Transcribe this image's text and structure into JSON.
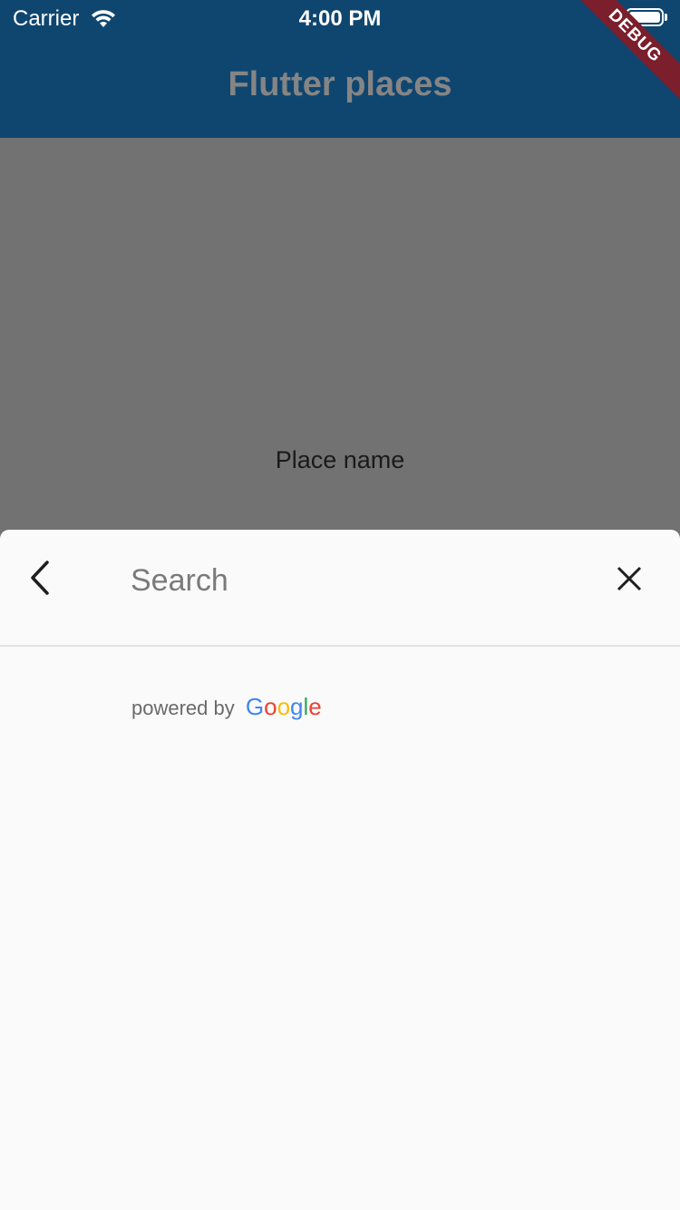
{
  "status_bar": {
    "carrier": "Carrier",
    "time": "4:00 PM",
    "wifi_icon": "wifi-icon",
    "battery_icon": "battery-icon"
  },
  "app_bar": {
    "title": "Flutter places",
    "background_color": "#0f4670"
  },
  "debug_banner": {
    "label": "DEBUG",
    "color": "#7a1f2b"
  },
  "body": {
    "place_name": "Place name"
  },
  "search_sheet": {
    "back_icon": "chevron-left-icon",
    "search_placeholder": "Search",
    "search_value": "",
    "clear_icon": "close-icon",
    "attribution_prefix": "powered by",
    "google_letters": [
      {
        "char": "G",
        "color": "#4285F4"
      },
      {
        "char": "o",
        "color": "#EA4335"
      },
      {
        "char": "o",
        "color": "#FBBC05"
      },
      {
        "char": "g",
        "color": "#4285F4"
      },
      {
        "char": "l",
        "color": "#34A853"
      },
      {
        "char": "e",
        "color": "#EA4335"
      }
    ]
  }
}
